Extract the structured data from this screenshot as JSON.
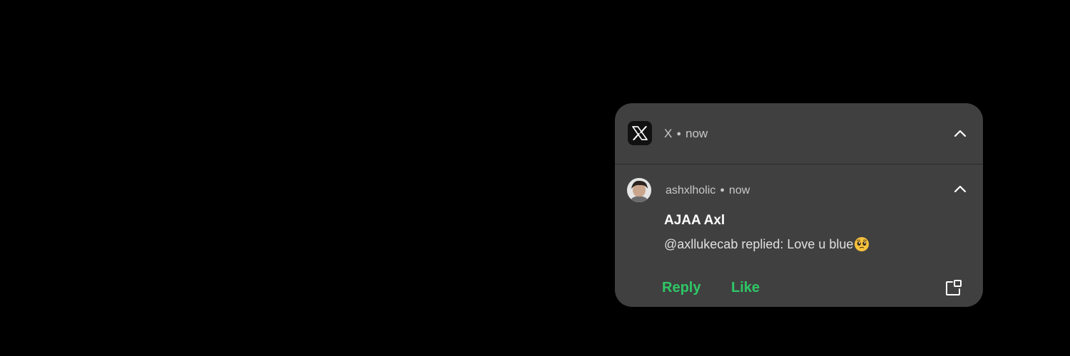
{
  "notification": {
    "app": {
      "name": "X",
      "time": "now",
      "icon": "x-logo-icon"
    },
    "message": {
      "sender": "ashxlholic",
      "time": "now",
      "title": "AJAA Axl",
      "body": "@axllukecab replied: Love u blue",
      "emoji": "pleading-face-emoji",
      "avatar": "avatar-photo"
    },
    "actions": {
      "reply_label": "Reply",
      "like_label": "Like"
    }
  },
  "colors": {
    "background": "#000000",
    "card": "#404040",
    "accent": "#2ec866",
    "text_primary": "#ffffff",
    "text_secondary": "#c8c8c8"
  }
}
